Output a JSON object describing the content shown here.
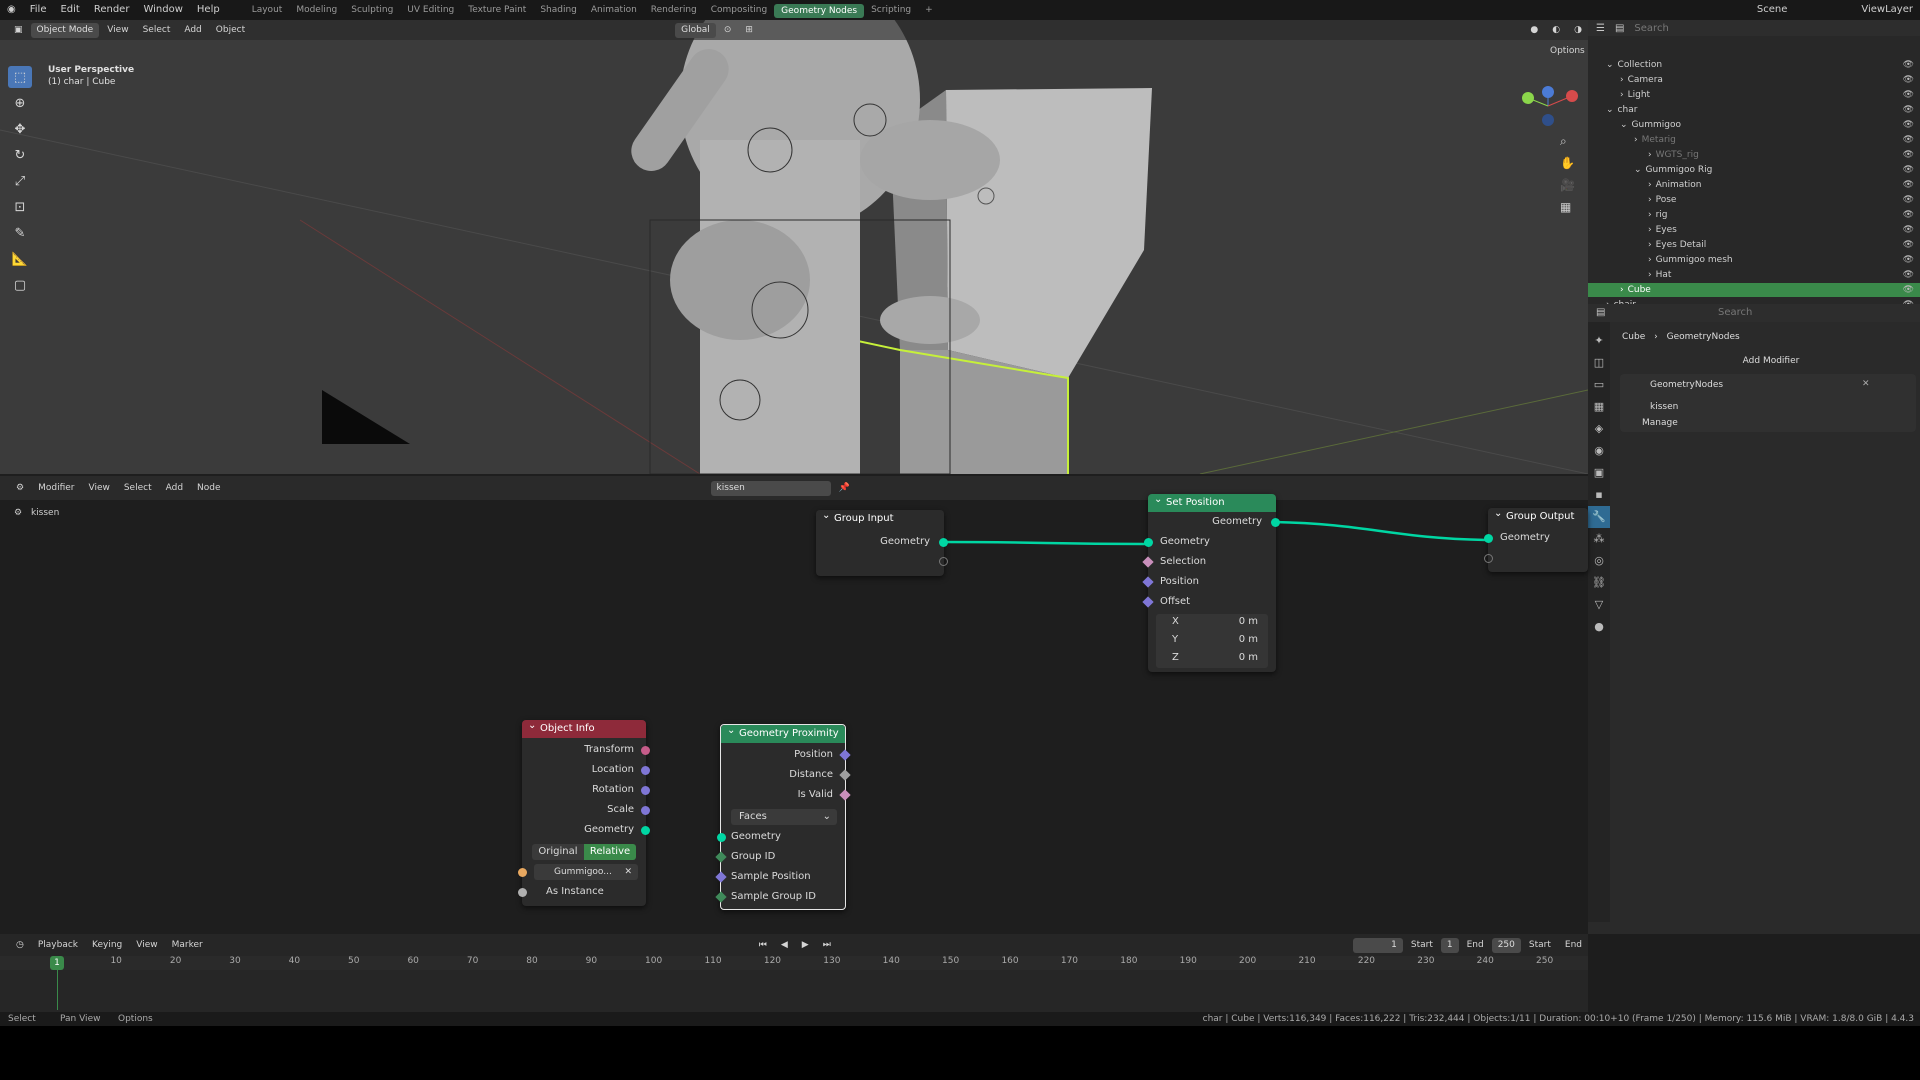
{
  "topbar": {
    "menus": [
      "File",
      "Edit",
      "Render",
      "Window",
      "Help"
    ],
    "workspaces": [
      "Layout",
      "Modeling",
      "Sculpting",
      "UV Editing",
      "Texture Paint",
      "Shading",
      "Animation",
      "Rendering",
      "Compositing",
      "Geometry Nodes",
      "Scripting"
    ],
    "active_workspace": "Geometry Nodes",
    "scene": "Scene",
    "view_layer": "ViewLayer"
  },
  "viewport": {
    "mode": "Object Mode",
    "menus": [
      "View",
      "Select",
      "Add",
      "Object"
    ],
    "transform_orientation": "Global",
    "options": "Options",
    "overlay_title": "User Perspective",
    "overlay_subtitle": "(1) char | Cube"
  },
  "outliner": {
    "search_placeholder": "Search",
    "items": [
      {
        "label": "Collection",
        "indent": 0,
        "expanded": true
      },
      {
        "label": "Camera",
        "indent": 1
      },
      {
        "label": "Light",
        "indent": 1
      },
      {
        "label": "char",
        "indent": 0,
        "expanded": true
      },
      {
        "label": "Gummigoo",
        "indent": 1,
        "expanded": true
      },
      {
        "label": "Metarig",
        "indent": 2,
        "dim": true
      },
      {
        "label": "WGTS_rig",
        "indent": 3,
        "dim": true
      },
      {
        "label": "Gummigoo Rig",
        "indent": 2,
        "expanded": true
      },
      {
        "label": "Animation",
        "indent": 3
      },
      {
        "label": "Pose",
        "indent": 3
      },
      {
        "label": "rig",
        "indent": 3
      },
      {
        "label": "Eyes",
        "indent": 3
      },
      {
        "label": "Eyes Detail",
        "indent": 3
      },
      {
        "label": "Gummigoo mesh",
        "indent": 3
      },
      {
        "label": "Hat",
        "indent": 3
      },
      {
        "label": "Cube",
        "indent": 1,
        "selected": true
      },
      {
        "label": "chair",
        "indent": 0
      }
    ]
  },
  "properties": {
    "search_placeholder": "Search",
    "breadcrumb_object": "Cube",
    "breadcrumb_modifier": "GeometryNodes",
    "add_modifier": "Add Modifier",
    "modifier_name": "GeometryNodes",
    "node_group": "kissen",
    "manage": "Manage"
  },
  "node_editor": {
    "menus": [
      "Modifier",
      "View",
      "Select",
      "Add",
      "Node"
    ],
    "node_tree": "kissen",
    "breadcrumb": "kissen",
    "group_input": {
      "title": "Group Input",
      "out_geometry": "Geometry"
    },
    "set_position": {
      "title": "Set Position",
      "out_geometry": "Geometry",
      "in": [
        "Geometry",
        "Selection",
        "Position",
        "Offset"
      ],
      "offset": [
        {
          "axis": "X",
          "value": "0 m"
        },
        {
          "axis": "Y",
          "value": "0 m"
        },
        {
          "axis": "Z",
          "value": "0 m"
        }
      ]
    },
    "group_output": {
      "title": "Group Output",
      "in_geometry": "Geometry"
    },
    "object_info": {
      "title": "Object Info",
      "outputs": [
        "Transform",
        "Location",
        "Rotation",
        "Scale",
        "Geometry"
      ],
      "toggle_original": "Original",
      "toggle_relative": "Relative",
      "object": "Gummigoo...",
      "as_instance": "As Instance"
    },
    "geometry_proximity": {
      "title": "Geometry Proximity",
      "outputs": [
        "Position",
        "Distance",
        "Is Valid"
      ],
      "mode": "Faces",
      "inputs": [
        "Geometry",
        "Group ID",
        "Sample Position",
        "Sample Group ID"
      ]
    }
  },
  "timeline": {
    "menus": [
      "Playback",
      "Keying",
      "View",
      "Marker"
    ],
    "current_frame": "1",
    "start_label": "Start",
    "start": "1",
    "end_label": "End",
    "end": "250",
    "start2": "Start",
    "end2": "End",
    "ticks": [
      "1",
      "10",
      "20",
      "30",
      "40",
      "50",
      "60",
      "70",
      "80",
      "90",
      "100",
      "110",
      "120",
      "130",
      "140",
      "150",
      "160",
      "170",
      "180",
      "190",
      "200",
      "210",
      "220",
      "230",
      "240",
      "250"
    ]
  },
  "statusbar": {
    "left": [
      "Select",
      "Pan View",
      "Options"
    ],
    "right": "char | Cube | Verts:116,349 | Faces:116,222 | Tris:232,444 | Objects:1/11 | Duration: 00:10+10 (Frame 1/250) | Memory: 115.6 MiB | VRAM: 1.8/8.0 GiB | 4.4.3"
  },
  "colors": {
    "accent_green": "#3a7a55",
    "node_geometry": "#00d6a3",
    "object_info_header": "#8e2a3a",
    "proximity_header": "#2a8a5a",
    "setpos_header": "#2a8a5a",
    "selected_row": "#3a8a4a"
  }
}
